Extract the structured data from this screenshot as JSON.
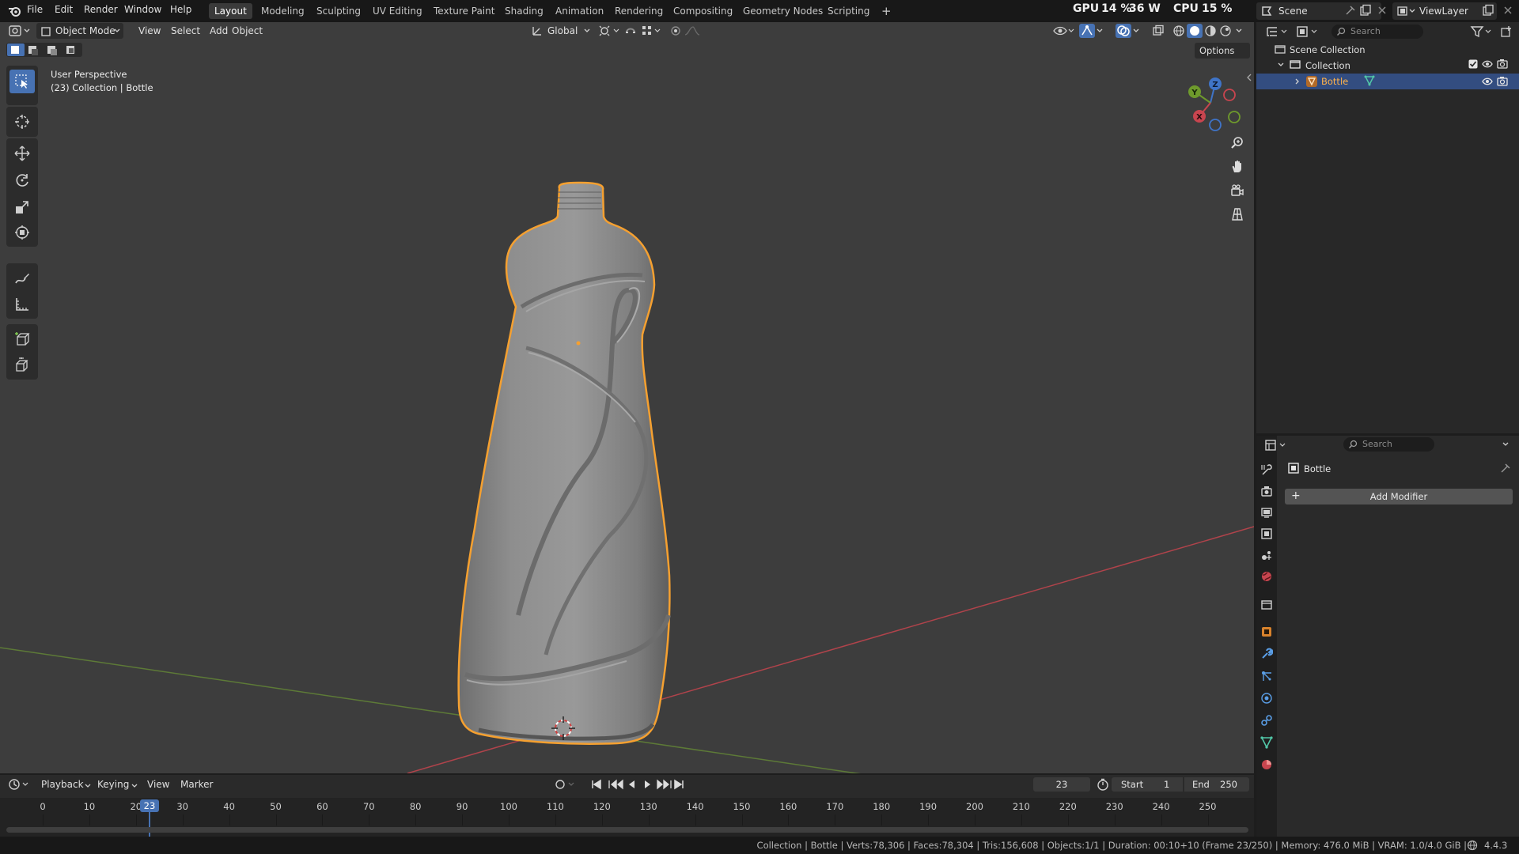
{
  "topbar": {
    "menus": [
      "File",
      "Edit",
      "Render",
      "Window",
      "Help"
    ],
    "workspaces": [
      "Layout",
      "Modeling",
      "Sculpting",
      "UV Editing",
      "Texture Paint",
      "Shading",
      "Animation",
      "Rendering",
      "Compositing",
      "Geometry Nodes",
      "Scripting"
    ],
    "active_workspace": "Layout",
    "add_workspace": "+",
    "gpu_label": "GPU",
    "gpu_value": "14 %",
    "gpu_power": "36 W",
    "cpu_label": "CPU",
    "cpu_value": "15 %",
    "scene": "Scene",
    "view_layer": "ViewLayer"
  },
  "viewport_header": {
    "mode": "Object Mode",
    "menus": [
      "View",
      "Select",
      "Add",
      "Object"
    ],
    "transform_orientation": "Global",
    "options": "Options"
  },
  "viewport": {
    "view_name": "User Perspective",
    "collection_info": "(23) Collection | Bottle",
    "gizmo_axes": {
      "x": "X",
      "y": "Y",
      "z": "Z"
    }
  },
  "outliner": {
    "search_placeholder": "Search",
    "scene_collection": "Scene Collection",
    "collection": "Collection",
    "object": "Bottle"
  },
  "properties": {
    "search_placeholder": "Search",
    "object_name": "Bottle",
    "add_modifier": "Add Modifier",
    "add_modifier_icon": "+"
  },
  "timeline": {
    "menus": [
      "Playback",
      "Keying",
      "View",
      "Marker"
    ],
    "current_frame": "23",
    "start_label": "Start",
    "start_value": "1",
    "end_label": "End",
    "end_value": "250",
    "ticks": [
      "0",
      "10",
      "20",
      "30",
      "40",
      "50",
      "60",
      "70",
      "80",
      "90",
      "100",
      "110",
      "120",
      "130",
      "140",
      "150",
      "160",
      "170",
      "180",
      "190",
      "200",
      "210",
      "220",
      "230",
      "240",
      "250"
    ]
  },
  "statusbar": {
    "text": "Collection | Bottle | Verts:78,306 | Faces:78,304 | Tris:156,608 | Objects:1/1 | Duration: 00:10+10 (Frame 23/250) | Memory: 476.0 MiB | VRAM: 1.0/4.0 GiB |",
    "version": "4.4.3"
  },
  "colors": {
    "accent": "#4772b3",
    "selection_outline": "#f5a030",
    "x_axis": "#c8454f",
    "y_axis": "#6e9a2c",
    "z_axis": "#3f74c8"
  }
}
